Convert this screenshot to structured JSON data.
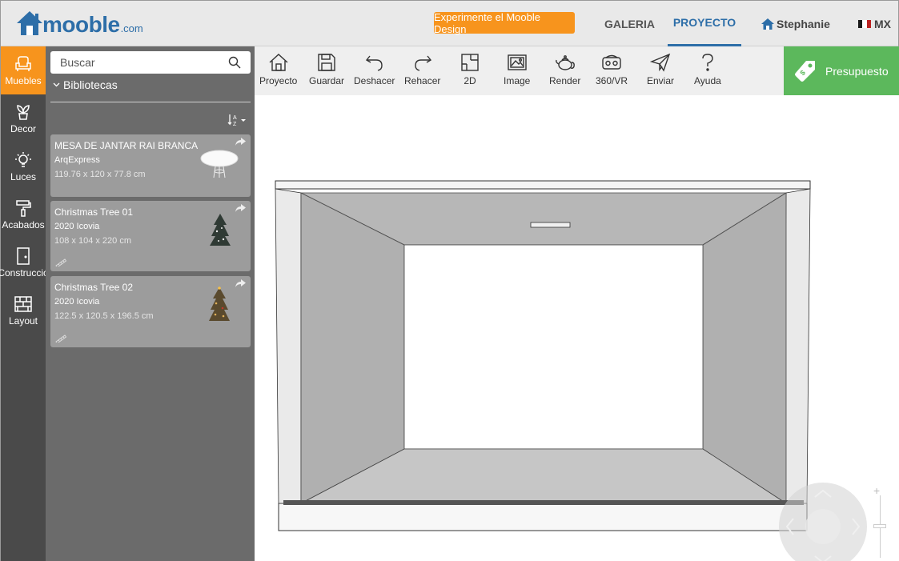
{
  "header": {
    "logo_text": "mooble",
    "logo_suffix": ".com",
    "promo_label": "Experimente el Mooble Design",
    "nav": {
      "galeria": "GALERIA",
      "proyecto": "PROYECTO",
      "user": "Stephanie",
      "country": "MX"
    }
  },
  "categories": [
    {
      "label": "Muebles",
      "icon": "armchair-icon",
      "active": true
    },
    {
      "label": "Decor",
      "icon": "plant-icon",
      "active": false
    },
    {
      "label": "Luces",
      "icon": "lightbulb-icon",
      "active": false
    },
    {
      "label": "Acabados",
      "icon": "paint-roller-icon",
      "active": false
    },
    {
      "label": "Construcció",
      "icon": "door-icon",
      "active": false
    },
    {
      "label": "Layout",
      "icon": "brick-wall-icon",
      "active": false
    }
  ],
  "library": {
    "search_placeholder": "Buscar",
    "libraries_label": "Bibliotecas",
    "items": [
      {
        "title": "MESA DE JANTAR RAI BRANCA",
        "brand": "ArqExpress",
        "dims": "119.76 x 120 x 77.8 cm"
      },
      {
        "title": "Christmas Tree 01",
        "brand": "2020 Icovia",
        "dims": "108 x 104 x 220 cm"
      },
      {
        "title": "Christmas Tree 02",
        "brand": "2020 Icovia",
        "dims": "122.5 x 120.5 x 196.5 cm"
      }
    ]
  },
  "toolbar": {
    "proyecto": "Proyecto",
    "guardar": "Guardar",
    "deshacer": "Deshacer",
    "rehacer": "Rehacer",
    "plan2d": "2D",
    "image": "Image",
    "render": "Render",
    "vr": "360/VR",
    "enviar": "Enviar",
    "ayuda": "Ayuda",
    "budget": "Presupuesto"
  },
  "colors": {
    "accent_orange": "#f7941d",
    "brand_blue": "#2d6ea8",
    "budget_green": "#5cb85c"
  }
}
